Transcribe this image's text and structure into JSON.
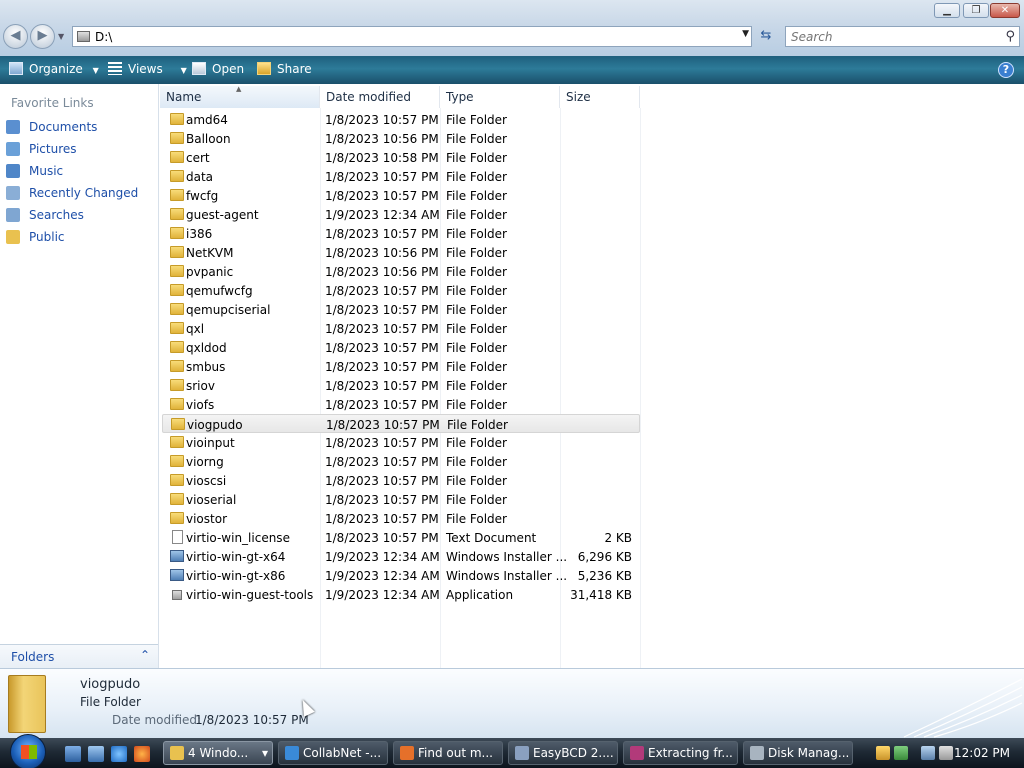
{
  "window": {
    "minimize": "▁",
    "maximize": "❐",
    "close": "✕"
  },
  "address": {
    "path": "D:\\",
    "search_placeholder": "Search"
  },
  "toolbar": {
    "organize": "Organize",
    "views": "Views",
    "open": "Open",
    "share": "Share",
    "help": "?"
  },
  "navpane": {
    "title": "Favorite Links",
    "links": [
      {
        "label": "Documents",
        "icon": "documents-icon",
        "color": "#5a8fd0"
      },
      {
        "label": "Pictures",
        "icon": "pictures-icon",
        "color": "#6aa0d8"
      },
      {
        "label": "Music",
        "icon": "music-icon",
        "color": "#4f86c8"
      },
      {
        "label": "Recently Changed",
        "icon": "recent-icon",
        "color": "#8aaed6"
      },
      {
        "label": "Searches",
        "icon": "searches-icon",
        "color": "#7fa6d2"
      },
      {
        "label": "Public",
        "icon": "public-folder-icon",
        "color": "#e9c14f"
      }
    ],
    "folders_label": "Folders",
    "folders_chevron": "⌃"
  },
  "columns": {
    "name": "Name",
    "date": "Date modified",
    "type": "Type",
    "size": "Size"
  },
  "files": [
    {
      "name": "amd64",
      "date": "1/8/2023 10:57 PM",
      "type": "File Folder",
      "size": "",
      "icon": "folder"
    },
    {
      "name": "Balloon",
      "date": "1/8/2023 10:56 PM",
      "type": "File Folder",
      "size": "",
      "icon": "folder"
    },
    {
      "name": "cert",
      "date": "1/8/2023 10:58 PM",
      "type": "File Folder",
      "size": "",
      "icon": "folder"
    },
    {
      "name": "data",
      "date": "1/8/2023 10:57 PM",
      "type": "File Folder",
      "size": "",
      "icon": "folder"
    },
    {
      "name": "fwcfg",
      "date": "1/8/2023 10:57 PM",
      "type": "File Folder",
      "size": "",
      "icon": "folder"
    },
    {
      "name": "guest-agent",
      "date": "1/9/2023 12:34 AM",
      "type": "File Folder",
      "size": "",
      "icon": "folder"
    },
    {
      "name": "i386",
      "date": "1/8/2023 10:57 PM",
      "type": "File Folder",
      "size": "",
      "icon": "folder"
    },
    {
      "name": "NetKVM",
      "date": "1/8/2023 10:56 PM",
      "type": "File Folder",
      "size": "",
      "icon": "folder"
    },
    {
      "name": "pvpanic",
      "date": "1/8/2023 10:56 PM",
      "type": "File Folder",
      "size": "",
      "icon": "folder"
    },
    {
      "name": "qemufwcfg",
      "date": "1/8/2023 10:57 PM",
      "type": "File Folder",
      "size": "",
      "icon": "folder"
    },
    {
      "name": "qemupciserial",
      "date": "1/8/2023 10:57 PM",
      "type": "File Folder",
      "size": "",
      "icon": "folder"
    },
    {
      "name": "qxl",
      "date": "1/8/2023 10:57 PM",
      "type": "File Folder",
      "size": "",
      "icon": "folder"
    },
    {
      "name": "qxldod",
      "date": "1/8/2023 10:57 PM",
      "type": "File Folder",
      "size": "",
      "icon": "folder"
    },
    {
      "name": "smbus",
      "date": "1/8/2023 10:57 PM",
      "type": "File Folder",
      "size": "",
      "icon": "folder"
    },
    {
      "name": "sriov",
      "date": "1/8/2023 10:57 PM",
      "type": "File Folder",
      "size": "",
      "icon": "folder"
    },
    {
      "name": "viofs",
      "date": "1/8/2023 10:57 PM",
      "type": "File Folder",
      "size": "",
      "icon": "folder"
    },
    {
      "name": "viogpudo",
      "date": "1/8/2023 10:57 PM",
      "type": "File Folder",
      "size": "",
      "icon": "folder",
      "selected": true
    },
    {
      "name": "vioinput",
      "date": "1/8/2023 10:57 PM",
      "type": "File Folder",
      "size": "",
      "icon": "folder"
    },
    {
      "name": "viorng",
      "date": "1/8/2023 10:57 PM",
      "type": "File Folder",
      "size": "",
      "icon": "folder"
    },
    {
      "name": "vioscsi",
      "date": "1/8/2023 10:57 PM",
      "type": "File Folder",
      "size": "",
      "icon": "folder"
    },
    {
      "name": "vioserial",
      "date": "1/8/2023 10:57 PM",
      "type": "File Folder",
      "size": "",
      "icon": "folder"
    },
    {
      "name": "viostor",
      "date": "1/8/2023 10:57 PM",
      "type": "File Folder",
      "size": "",
      "icon": "folder"
    },
    {
      "name": "virtio-win_license",
      "date": "1/8/2023 10:57 PM",
      "type": "Text Document",
      "size": "2 KB",
      "icon": "text"
    },
    {
      "name": "virtio-win-gt-x64",
      "date": "1/9/2023 12:34 AM",
      "type": "Windows Installer ...",
      "size": "6,296 KB",
      "icon": "msi"
    },
    {
      "name": "virtio-win-gt-x86",
      "date": "1/9/2023 12:34 AM",
      "type": "Windows Installer ...",
      "size": "5,236 KB",
      "icon": "msi"
    },
    {
      "name": "virtio-win-guest-tools",
      "date": "1/9/2023 12:34 AM",
      "type": "Application",
      "size": "31,418 KB",
      "icon": "app"
    }
  ],
  "details": {
    "name": "viogpudo",
    "type": "File Folder",
    "date_label": "Date modified:",
    "date": "1/8/2023 10:57 PM"
  },
  "taskbar": {
    "tasks": [
      {
        "label": "4 Windo...",
        "icon": "explorer-folder-icon",
        "color": "#e9c14f",
        "active": true,
        "has_dropdown": true
      },
      {
        "label": "CollabNet -...",
        "icon": "ie-icon",
        "color": "#3a8ad8"
      },
      {
        "label": "Find out m...",
        "icon": "firefox-icon",
        "color": "#e5702a"
      },
      {
        "label": "EasyBCD 2....",
        "icon": "easybcd-icon",
        "color": "#8aa0c0"
      },
      {
        "label": "Extracting fr...",
        "icon": "winrar-icon",
        "color": "#b23a7a"
      },
      {
        "label": "Disk Manag...",
        "icon": "disk-management-icon",
        "color": "#a8b4c0"
      }
    ],
    "clock": "12:02 PM",
    "dropdown_glyph": "▾"
  }
}
